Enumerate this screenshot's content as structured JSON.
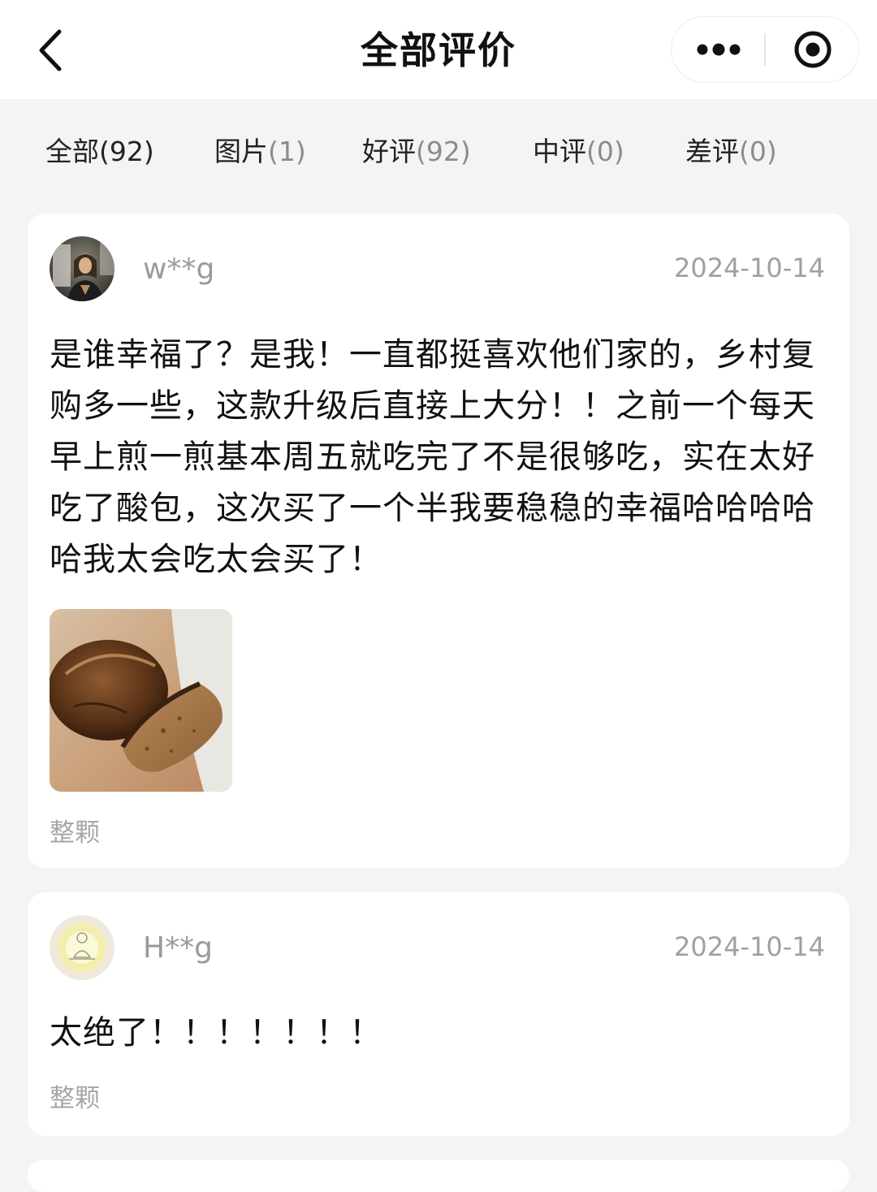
{
  "header": {
    "title": "全部评价",
    "back_icon": "chevron-left-icon",
    "more_icon": "more-dots-icon",
    "close_icon": "target-close-icon"
  },
  "tabs": [
    {
      "label": "全部",
      "count": "(92)",
      "active": true
    },
    {
      "label": "图片",
      "count": "(1)"
    },
    {
      "label": "好评",
      "count": "(92)"
    },
    {
      "label": "中评",
      "count": "(0)"
    },
    {
      "label": "差评",
      "count": "(0)"
    }
  ],
  "reviews": [
    {
      "user": "w**g",
      "date": "2024-10-14",
      "content": "是谁幸福了？是我！一直都挺喜欢他们家的，乡村复购多一些，这款升级后直接上大分！！之前一个每天早上煎一煎基本周五就吃完了不是很够吃，实在太好吃了酸包，这次买了一个半我要稳稳的幸福哈哈哈哈哈我太会吃太会买了！",
      "spec": "整颗"
    },
    {
      "user": "H**g",
      "date": "2024-10-14",
      "content": "太绝了！！！！！！！",
      "spec": "整颗"
    }
  ],
  "colors": {
    "background": "#f4f4f4",
    "card": "#ffffff",
    "muted_text": "#9a9a9a"
  }
}
